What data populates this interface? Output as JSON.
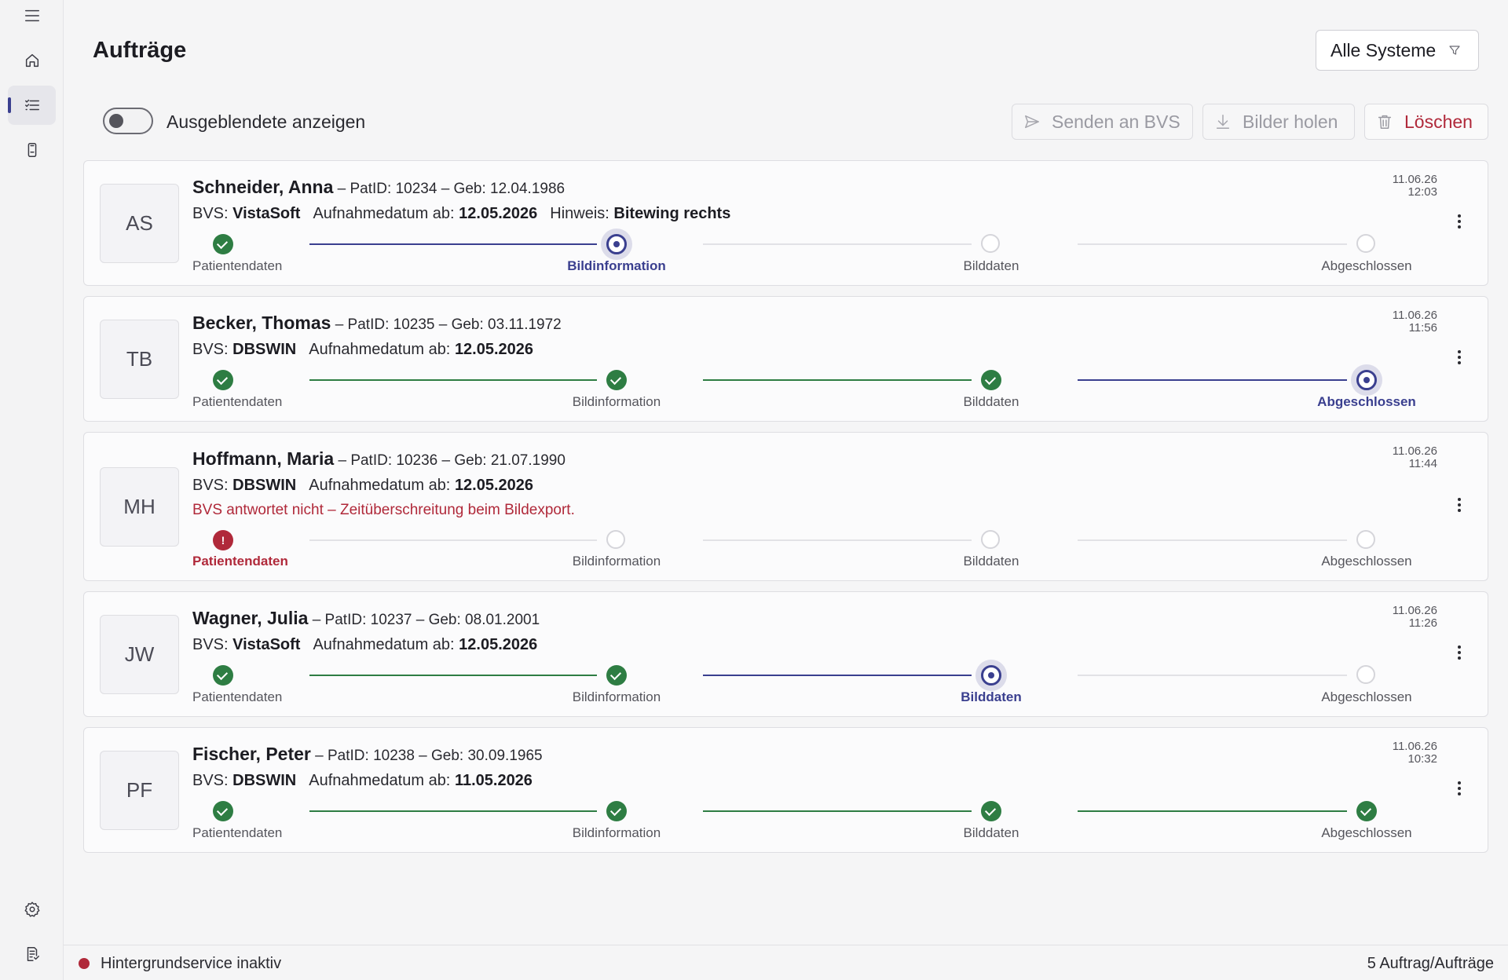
{
  "header": {
    "title": "Aufträge",
    "system_filter": "Alle Systeme",
    "toggle_label": "Ausgeblendete anzeigen",
    "send_label": "Senden an BVS",
    "fetch_label": "Bilder holen",
    "delete_label": "Löschen"
  },
  "steps": [
    "Patientendaten",
    "Bildinformation",
    "Bilddaten",
    "Abgeschlossen"
  ],
  "orders": [
    {
      "initials": "AS",
      "name": "Schneider, Anna",
      "meta": "– PatID: 10234 – Geb: 12.04.1986",
      "bvs_label": "BVS:",
      "bvs": "VistaSoft",
      "date_label": "Aufnahmedatum ab:",
      "date": "12.05.2026",
      "hint_label": "Hinweis:",
      "hint": "Bitewing rechts",
      "error": "",
      "ts_date": "11.06.26",
      "ts_time": "12:03",
      "states": [
        "done",
        "cur",
        "todo",
        "todo"
      ]
    },
    {
      "initials": "TB",
      "name": "Becker, Thomas",
      "meta": "– PatID: 10235 – Geb: 03.11.1972",
      "bvs_label": "BVS:",
      "bvs": "DBSWIN",
      "date_label": "Aufnahmedatum ab:",
      "date": "12.05.2026",
      "hint_label": "",
      "hint": "",
      "error": "",
      "ts_date": "11.06.26",
      "ts_time": "11:56",
      "states": [
        "done",
        "done",
        "done",
        "cur"
      ]
    },
    {
      "initials": "MH",
      "name": "Hoffmann, Maria",
      "meta": "– PatID: 10236 – Geb: 21.07.1990",
      "bvs_label": "BVS:",
      "bvs": "DBSWIN",
      "date_label": "Aufnahmedatum ab:",
      "date": "12.05.2026",
      "hint_label": "",
      "hint": "",
      "error": "BVS antwortet nicht – Zeitüberschreitung beim Bildexport.",
      "ts_date": "11.06.26",
      "ts_time": "11:44",
      "states": [
        "err",
        "todo",
        "todo",
        "todo"
      ]
    },
    {
      "initials": "JW",
      "name": "Wagner, Julia",
      "meta": "– PatID: 10237 – Geb: 08.01.2001",
      "bvs_label": "BVS:",
      "bvs": "VistaSoft",
      "date_label": "Aufnahmedatum ab:",
      "date": "12.05.2026",
      "hint_label": "",
      "hint": "",
      "error": "",
      "ts_date": "11.06.26",
      "ts_time": "11:26",
      "states": [
        "done",
        "done",
        "cur",
        "todo"
      ]
    },
    {
      "initials": "PF",
      "name": "Fischer, Peter",
      "meta": "– PatID: 10238 – Geb: 30.09.1965",
      "bvs_label": "BVS:",
      "bvs": "DBSWIN",
      "date_label": "Aufnahmedatum ab:",
      "date": "11.05.2026",
      "hint_label": "",
      "hint": "",
      "error": "",
      "ts_date": "11.06.26",
      "ts_time": "10:32",
      "states": [
        "done",
        "done",
        "done",
        "done"
      ]
    }
  ],
  "statusbar": {
    "service": "Hintergrundservice inaktiv",
    "count": "5 Auftrag/Aufträge"
  },
  "colors": {
    "accent": "#3a3f8f",
    "success": "#2e7d43",
    "error": "#b0293a"
  },
  "icons": [
    "menu-icon",
    "home-icon",
    "list-icon",
    "device-icon",
    "settings-icon",
    "log-icon",
    "filter-icon",
    "send-icon",
    "download-icon",
    "trash-icon",
    "kebab-icon"
  ]
}
